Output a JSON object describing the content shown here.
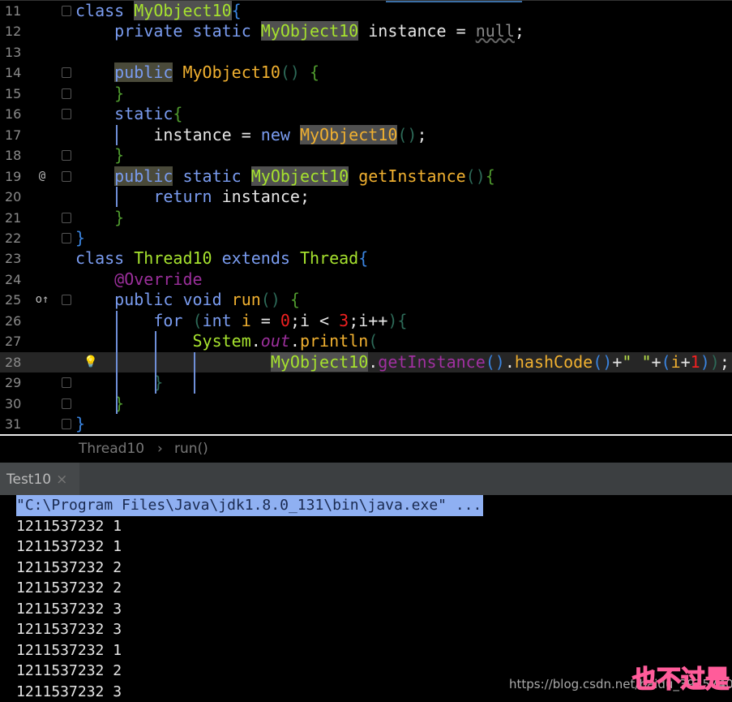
{
  "editor": {
    "lines": [
      {
        "n": "11",
        "t": [
          [
            "class ",
            "kw"
          ],
          [
            "MyObject10",
            "clsh"
          ],
          [
            "{",
            "bb"
          ]
        ]
      },
      {
        "n": "12",
        "t": [
          [
            "    private static ",
            "kw"
          ],
          [
            "MyObject10",
            "clsh"
          ],
          [
            " instance = ",
            "pl"
          ],
          [
            "null",
            "nul"
          ],
          [
            ";",
            "pl"
          ]
        ]
      },
      {
        "n": "13",
        "t": []
      },
      {
        "n": "14",
        "t": [
          [
            "    ",
            "pl"
          ],
          [
            "public",
            "kwh"
          ],
          [
            " ",
            "pl"
          ],
          [
            "MyObject10",
            "fn"
          ],
          [
            "()",
            "p"
          ],
          [
            " {",
            "br"
          ]
        ]
      },
      {
        "n": "15",
        "t": [
          [
            "    }",
            "br"
          ]
        ]
      },
      {
        "n": "16",
        "t": [
          [
            "    static",
            "kw"
          ],
          [
            "{",
            "br"
          ]
        ]
      },
      {
        "n": "17",
        "t": [
          [
            "        instance = ",
            "pl"
          ],
          [
            "new ",
            "kw"
          ],
          [
            "MyObject10",
            "fnh"
          ],
          [
            "()",
            "p"
          ],
          [
            ";",
            "pl"
          ]
        ]
      },
      {
        "n": "18",
        "t": [
          [
            "    }",
            "br"
          ]
        ]
      },
      {
        "n": "19",
        "g": "@",
        "t": [
          [
            "    ",
            "pl"
          ],
          [
            "public",
            "kwh"
          ],
          [
            " static ",
            "kw"
          ],
          [
            "MyObject10",
            "clsh"
          ],
          [
            " ",
            "pl"
          ],
          [
            "getInstance",
            "fn"
          ],
          [
            "()",
            "p"
          ],
          [
            "{",
            "br"
          ]
        ]
      },
      {
        "n": "20",
        "t": [
          [
            "        return ",
            "kw"
          ],
          [
            "instance;",
            "pl"
          ]
        ]
      },
      {
        "n": "21",
        "t": [
          [
            "    }",
            "br"
          ]
        ]
      },
      {
        "n": "22",
        "t": [
          [
            "}",
            "bb"
          ]
        ]
      },
      {
        "n": "23",
        "t": [
          [
            "class ",
            "kw"
          ],
          [
            "Thread10",
            "cls"
          ],
          [
            " extends ",
            "kw"
          ],
          [
            "Thread",
            "cls"
          ],
          [
            "{",
            "bb"
          ]
        ]
      },
      {
        "n": "24",
        "t": [
          [
            "    @Override",
            "ann"
          ]
        ]
      },
      {
        "n": "25",
        "g": "o↑",
        "t": [
          [
            "    public void ",
            "kw"
          ],
          [
            "run",
            "fn"
          ],
          [
            "()",
            "p"
          ],
          [
            " {",
            "br"
          ]
        ]
      },
      {
        "n": "26",
        "t": [
          [
            "        for ",
            "kw"
          ],
          [
            "(",
            "p"
          ],
          [
            "int ",
            "kw"
          ],
          [
            "i",
            "var"
          ],
          [
            " = ",
            "pl"
          ],
          [
            "0",
            "num"
          ],
          [
            ";i < ",
            "pl"
          ],
          [
            "3",
            "num"
          ],
          [
            ";i++",
            "pl"
          ],
          [
            "){",
            "p"
          ]
        ]
      },
      {
        "n": "27",
        "t": [
          [
            "            System",
            "cls"
          ],
          [
            ".",
            "pl"
          ],
          [
            "out",
            "ital"
          ],
          [
            ".",
            "pl"
          ],
          [
            "println",
            "fn"
          ],
          [
            "(",
            "p"
          ]
        ]
      },
      {
        "n": "28",
        "g": "💡",
        "cur": true,
        "t": [
          [
            "                    ",
            "pl"
          ],
          [
            "MyObject10",
            "clsh"
          ],
          [
            ".",
            "pl"
          ],
          [
            "getInstance",
            "meth"
          ],
          [
            "()",
            "bb"
          ],
          [
            ".",
            "pl"
          ],
          [
            "hashCode",
            "fn"
          ],
          [
            "()",
            "bb"
          ],
          [
            "+",
            "pl"
          ],
          [
            "\" \"",
            "str"
          ],
          [
            "+",
            "pl"
          ],
          [
            "(",
            "bb"
          ],
          [
            "i",
            "var"
          ],
          [
            "+",
            "pl"
          ],
          [
            "1",
            "num"
          ],
          [
            ")",
            "bb"
          ],
          [
            ")",
            "p"
          ],
          [
            ";",
            "pl"
          ]
        ]
      },
      {
        "n": "29",
        "t": [
          [
            "        }",
            "p"
          ]
        ]
      },
      {
        "n": "30",
        "t": [
          [
            "    }",
            "br"
          ]
        ]
      },
      {
        "n": "31",
        "t": [
          [
            "}",
            "bb"
          ]
        ]
      }
    ]
  },
  "breadcrumb": {
    "items": [
      "Thread10",
      "run()"
    ],
    "sep": "›"
  },
  "console": {
    "tab": "Test10",
    "close": "×",
    "lines": [
      "\"C:\\Program Files\\Java\\jdk1.8.0_131\\bin\\java.exe\" ...",
      "1211537232 1",
      "1211537232 1",
      "1211537232 2",
      "1211537232 2",
      "1211537232 3",
      "1211537232 3",
      "1211537232 1",
      "1211537232 2",
      "1211537232 3"
    ]
  },
  "watermark": {
    "url": "https://blog.csdn.net/baidu_39357407",
    "stamp": "也不过是"
  }
}
